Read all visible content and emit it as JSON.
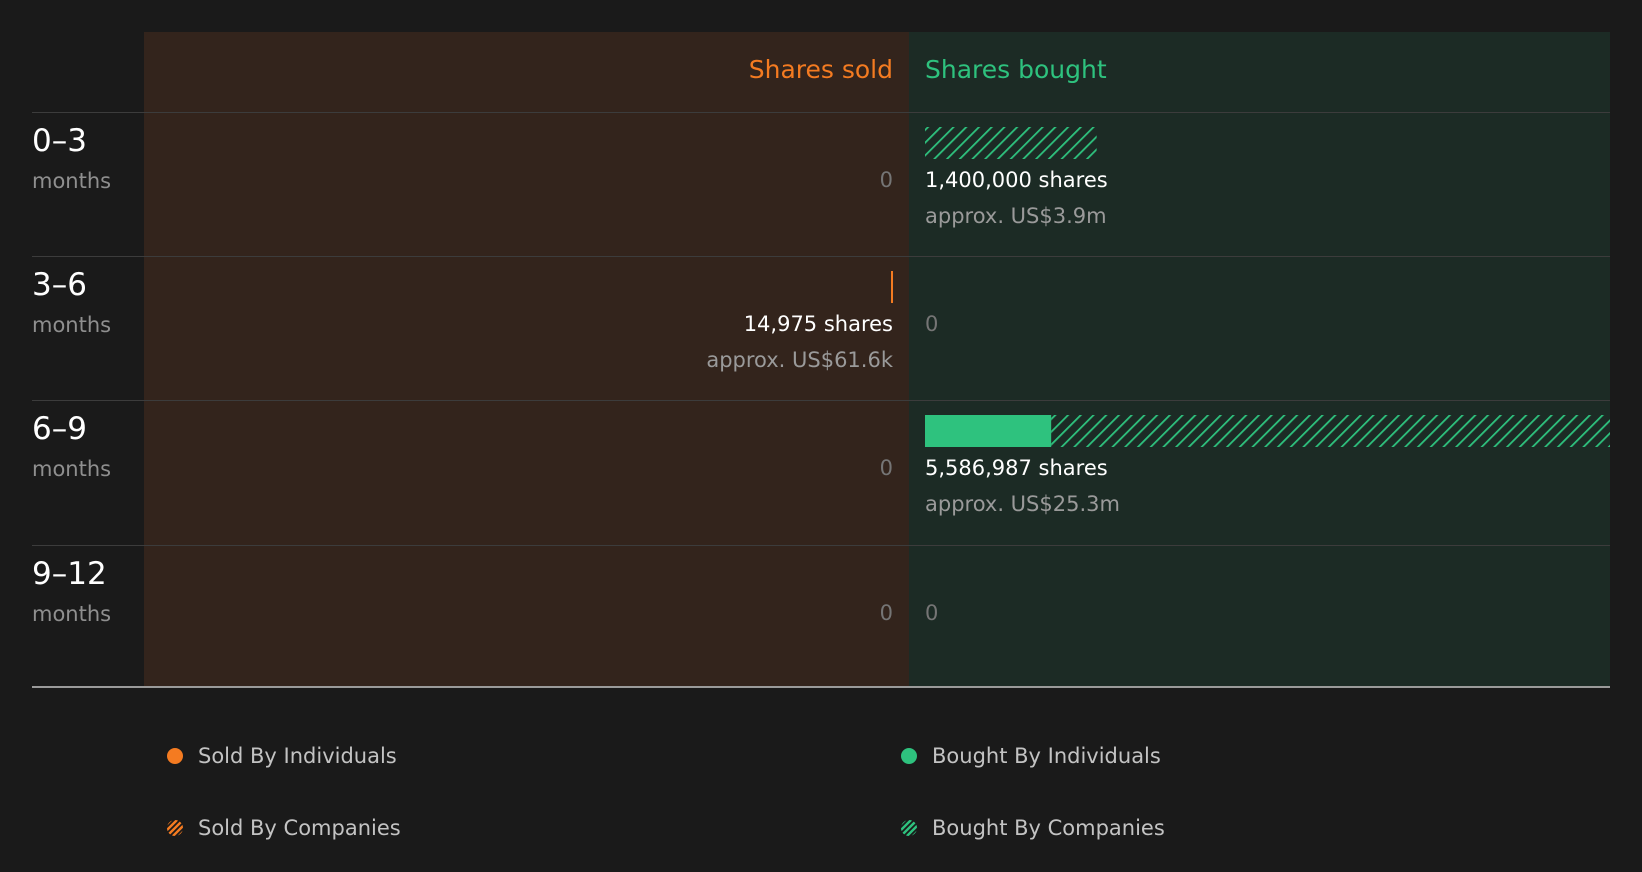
{
  "colors": {
    "sold": "#f47b21",
    "bought": "#2ec27e"
  },
  "chart_data": {
    "type": "bar",
    "orientation": "diverging-horizontal",
    "headers": {
      "sold": "Shares sold",
      "bought": "Shares bought"
    },
    "rows": [
      {
        "period": "0–3",
        "unit": "months",
        "sold": {
          "individuals": 0,
          "companies": 0,
          "shares_label": "",
          "approx_label": "",
          "zero_label": "0"
        },
        "bought": {
          "individuals": 0,
          "companies": 1400000,
          "shares_label": "1,400,000 shares",
          "approx_label": "approx. US$3.9m",
          "zero_label": ""
        }
      },
      {
        "period": "3–6",
        "unit": "months",
        "sold": {
          "individuals": 14975,
          "companies": 0,
          "shares_label": "14,975 shares",
          "approx_label": "approx. US$61.6k",
          "zero_label": ""
        },
        "bought": {
          "individuals": 0,
          "companies": 0,
          "shares_label": "",
          "approx_label": "",
          "zero_label": "0"
        }
      },
      {
        "period": "6–9",
        "unit": "months",
        "sold": {
          "individuals": 0,
          "companies": 0,
          "shares_label": "",
          "approx_label": "",
          "zero_label": "0"
        },
        "bought": {
          "individuals": 1030000,
          "companies": 4556987,
          "shares_label": "5,586,987 shares",
          "approx_label": "approx. US$25.3m",
          "zero_label": ""
        }
      },
      {
        "period": "9–12",
        "unit": "months",
        "sold": {
          "individuals": 0,
          "companies": 0,
          "shares_label": "",
          "approx_label": "",
          "zero_label": "0"
        },
        "bought": {
          "individuals": 0,
          "companies": 0,
          "shares_label": "",
          "approx_label": "",
          "zero_label": "0"
        }
      }
    ],
    "legend": [
      {
        "label": "Sold By Individuals",
        "side": "sold",
        "style": "solid"
      },
      {
        "label": "Bought By Individuals",
        "side": "bought",
        "style": "solid"
      },
      {
        "label": "Sold By Companies",
        "side": "sold",
        "style": "hatched"
      },
      {
        "label": "Bought By Companies",
        "side": "bought",
        "style": "hatched"
      }
    ],
    "scale_max_shares": 5586987
  }
}
